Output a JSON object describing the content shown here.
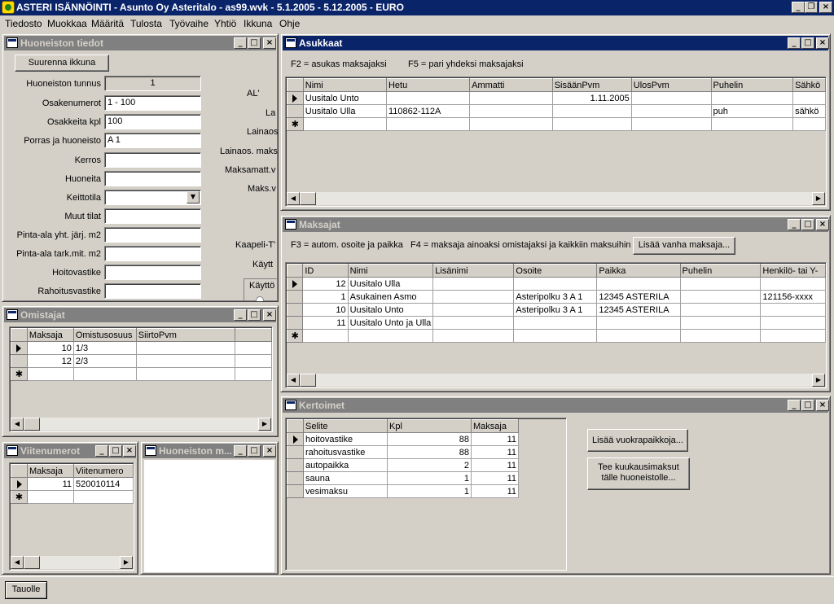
{
  "app": {
    "title": "ASTERI ISÄNNÖINTI - Asunto Oy Asteritalo - as99.wvk - 5.1.2005 - 5.12.2005 - EURO"
  },
  "menu": [
    "Tiedosto",
    "Muokkaa",
    "Määritä",
    "Tulosta",
    "Työvaihe",
    "Yhtiö",
    "Ikkuna",
    "Ohje"
  ],
  "huoneisto": {
    "title": "Huoneiston tiedot",
    "enlarge_button": "Suurenna ikkuna",
    "fields": [
      {
        "label": "Huoneiston tunnus",
        "value": "1"
      },
      {
        "label": "Osakenumerot",
        "value": "1 - 100"
      },
      {
        "label": "Osakkeita kpl",
        "value": "100"
      },
      {
        "label": "Porras ja huoneisto",
        "value": "A 1"
      },
      {
        "label": "Kerros",
        "value": ""
      },
      {
        "label": "Huoneita",
        "value": ""
      },
      {
        "label": "Keittotila",
        "value": ""
      },
      {
        "label": "Muut tilat",
        "value": ""
      },
      {
        "label": "Pinta-ala yht. järj. m2",
        "value": ""
      },
      {
        "label": "Pinta-ala tark.mit. m2",
        "value": ""
      },
      {
        "label": "Hoitovastike",
        "value": ""
      },
      {
        "label": "Rahoitusvastike",
        "value": ""
      }
    ],
    "right_labels": [
      "AL'",
      "La",
      "Lainaos",
      "Lainaos. maks",
      "Maksamatt.v",
      "Maks.v",
      "Kaapeli-T'",
      "Käytt",
      "Käyttö"
    ]
  },
  "omistajat": {
    "title": "Omistajat",
    "columns": [
      "Maksaja",
      "Omistusosuus",
      "SiirtoPvm",
      ""
    ],
    "rows": [
      [
        "10",
        "1/3",
        "",
        ""
      ],
      [
        "12",
        "2/3",
        "",
        ""
      ]
    ]
  },
  "viitenumerot": {
    "title": "Viitenumerot",
    "columns": [
      "Maksaja",
      "Viitenumero"
    ],
    "rows": [
      [
        "11",
        "520010114"
      ]
    ]
  },
  "huoneiston_m": {
    "title": "Huoneiston m..."
  },
  "asukkaat": {
    "title": "Asukkaat",
    "hint1": "F2 = asukas maksajaksi",
    "hint2": "F5 = pari yhdeksi maksajaksi",
    "columns": [
      "Nimi",
      "Hetu",
      "Ammatti",
      "SisäänPvm",
      "UlosPvm",
      "Puhelin",
      "Sähkö"
    ],
    "rows": [
      [
        "Uusitalo Unto",
        "",
        "",
        "1.11.2005",
        "",
        "",
        ""
      ],
      [
        "Uusitalo Ulla",
        "110862-112A",
        "",
        "",
        "",
        "puh",
        "sähkö"
      ]
    ]
  },
  "maksajat": {
    "title": "Maksajat",
    "hint1": "F3 = autom. osoite ja paikka",
    "hint2": "F4 = maksaja ainoaksi omistajaksi ja kaikkiin maksuihin",
    "add_button": "Lisää vanha maksaja...",
    "columns": [
      "ID",
      "Nimi",
      "Lisänimi",
      "Osoite",
      "Paikka",
      "Puhelin",
      "Henkilö- tai Y-"
    ],
    "rows": [
      [
        "12",
        "Uusitalo Ulla",
        "",
        "",
        "",
        "",
        ""
      ],
      [
        "1",
        "Asukainen Asmo",
        "",
        "Asteripolku 3 A 1",
        "12345 ASTERILA",
        "",
        "121156-xxxx"
      ],
      [
        "10",
        "Uusitalo Unto",
        "",
        "Asteripolku 3 A 1",
        "12345 ASTERILA",
        "",
        ""
      ],
      [
        "11",
        "Uusitalo Unto ja Ulla",
        "",
        "",
        "",
        "",
        ""
      ]
    ]
  },
  "kertoimet": {
    "title": "Kertoimet",
    "columns": [
      "Selite",
      "Kpl",
      "Maksaja"
    ],
    "rows": [
      [
        "hoitovastike",
        "88",
        "11"
      ],
      [
        "rahoitusvastike",
        "88",
        "11"
      ],
      [
        "autopaikka",
        "2",
        "11"
      ],
      [
        "sauna",
        "1",
        "11"
      ],
      [
        "vesimaksu",
        "1",
        "11"
      ]
    ],
    "button1": "Lisää vuokrapaikkoja...",
    "button2_line1": "Tee kuukausimaksut",
    "button2_line2": "tälle huoneistolle..."
  },
  "statusbar": {
    "back_button": "Tauolle"
  },
  "icons": {
    "min": "minimize-icon",
    "max": "maximize-icon",
    "close": "close-icon",
    "restore": "restore-icon"
  }
}
